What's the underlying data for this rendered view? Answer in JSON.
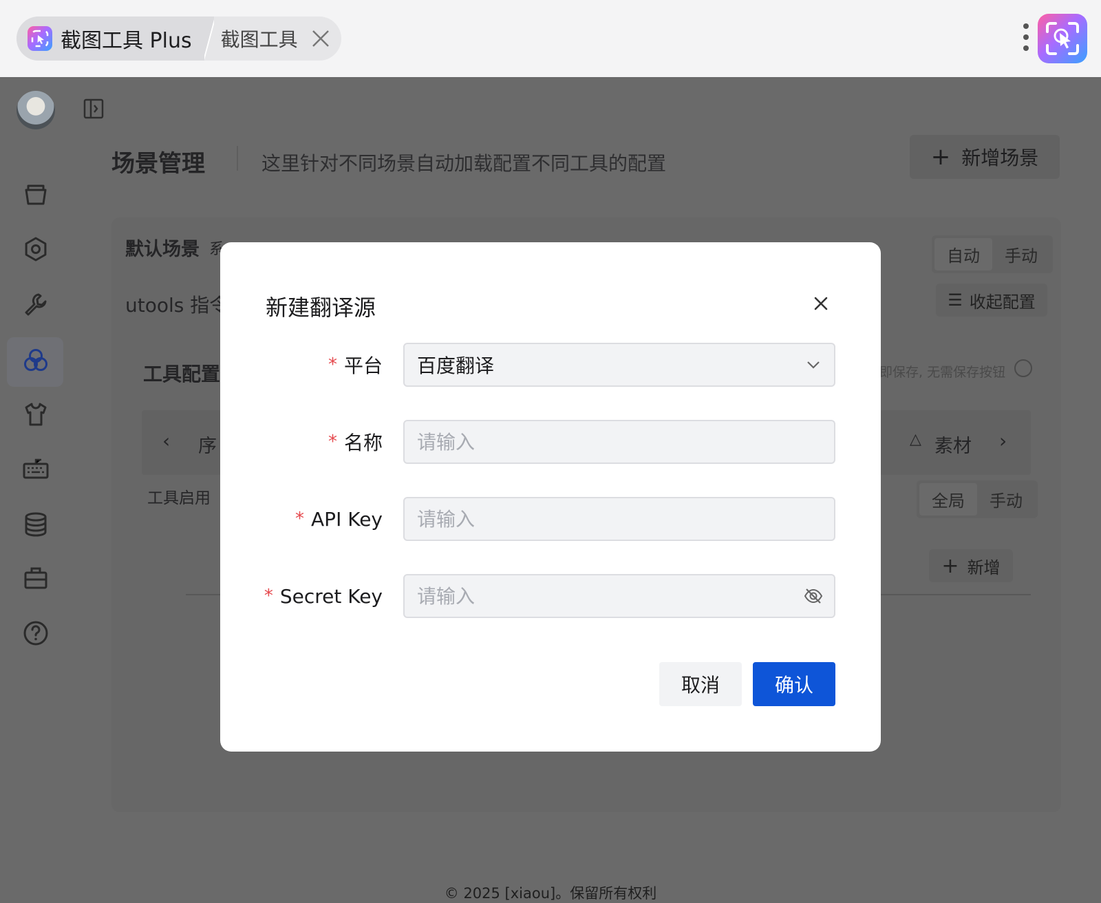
{
  "titlebar": {
    "app_tab_label": "截图工具 Plus",
    "second_tab_label": "截图工具",
    "logo_icon": "screenshot-cursor-icon",
    "menu_icon": "vertical-dots-icon"
  },
  "sidebar": {
    "items": [
      {
        "icon": "folder-open-icon"
      },
      {
        "icon": "gear-icon"
      },
      {
        "icon": "wrench-icon"
      },
      {
        "icon": "circles-icon",
        "active": true
      },
      {
        "icon": "shirt-icon"
      },
      {
        "icon": "keyboard-icon"
      },
      {
        "icon": "database-icon"
      },
      {
        "icon": "toolbox-icon"
      },
      {
        "icon": "help-icon"
      }
    ]
  },
  "header": {
    "title": "场景管理",
    "description": "这里针对不同场景自动加载配置不同工具的配置",
    "add_button": "新增场景"
  },
  "background": {
    "default_scene": "默认场景",
    "default_scene_suffix": "系",
    "mode_auto": "自动",
    "mode_manual": "手动",
    "utools_label": "utools 指令",
    "collapse_config": "收起配置",
    "tool_config": "工具配置",
    "autosave_hint": "即保存, 无需保存按钮",
    "tab_order": "序",
    "tab_assets": "素材",
    "tool_enable": "工具启用",
    "scope_global": "全局",
    "scope_manual": "手动",
    "add": "新增",
    "footer": "© 2025 [xiaou]。保留所有权利"
  },
  "modal": {
    "title": "新建翻译源",
    "fields": {
      "platform": {
        "label": "平台",
        "value": "百度翻译"
      },
      "name": {
        "label": "名称",
        "placeholder": "请输入"
      },
      "api_key": {
        "label": "API Key",
        "placeholder": "请输入"
      },
      "secret_key": {
        "label": "Secret Key",
        "placeholder": "请输入"
      }
    },
    "cancel": "取消",
    "confirm": "确认"
  },
  "colors": {
    "primary": "#0e55d8",
    "required": "#e5484d",
    "overlay": "#6a6a6a"
  }
}
